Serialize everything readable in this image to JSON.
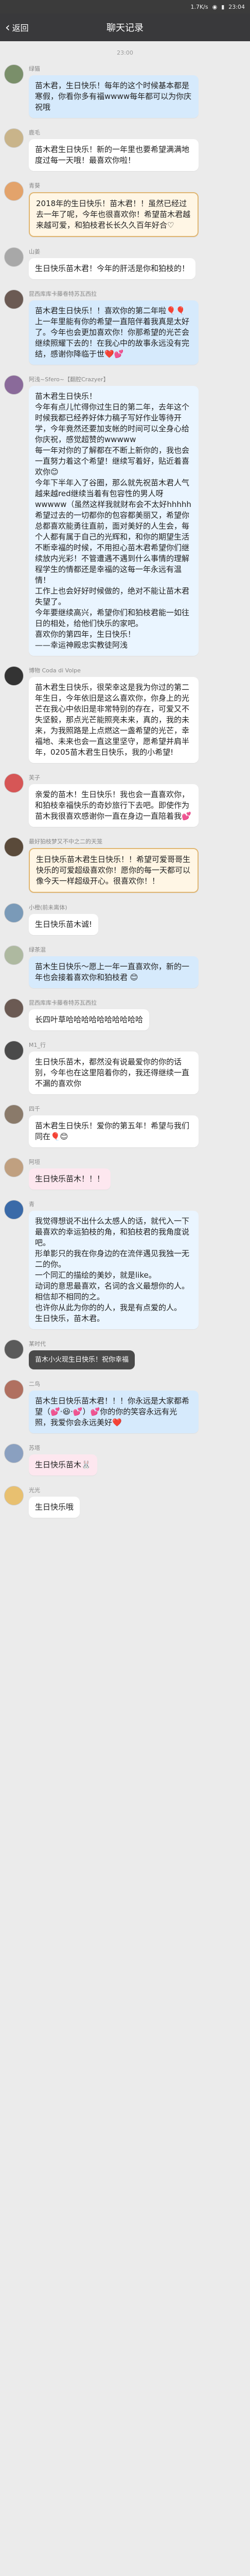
{
  "status_bar": {
    "signal": "1.7K/s",
    "battery": "23:04"
  },
  "nav": {
    "back_label": "返回",
    "title": "聊天记录"
  },
  "time_label": "23:00",
  "messages": [
    {
      "name": "绿猫",
      "avatar_color": "#7a8f6a",
      "style": "blue",
      "text": "苗木君，生日快乐！每年的这个时候基本都是寒假，你看你多有福wwww每年都可以为你庆祝哦"
    },
    {
      "name": "鹿毛",
      "avatar_color": "#c9b48a",
      "style": "plain",
      "text": "苗木君生日快乐！新的一年里也要希望满满地度过每一天哦！最喜欢你啦！"
    },
    {
      "name": "青葵",
      "avatar_color": "#e3a36b",
      "style": "gold",
      "text": "2018年的生日快乐！苗木君！！虽然已经过去一年了呢，今年也很喜欢你！希望苗木君越来越可爱，和狛枝君长长久久百年好合♡"
    },
    {
      "name": "山姜",
      "avatar_color": "#a8a8a8",
      "style": "plain",
      "text": "生日快乐苗木君！今年的肝活是你和狛枝的！"
    },
    {
      "name": "昆西库库卡藤卷特苏瓦西拉",
      "avatar_color": "#6b5a53",
      "style": "blue",
      "text": "苗木君生日快乐！！喜欢你的第二年啦🎈🎈上一年里能有你的希望一直陪伴着我真是太好了。今年也会更加喜欢你！你那希望的光芒会继续照耀下去的！在我心中的故事永远没有完结，感谢你降临于世❤️💕"
    },
    {
      "name": "阿浅~Sfero~【翻腔Crazyer】",
      "avatar_color": "#8a6a9a",
      "style": "lightblue",
      "text": "苗木君生日快乐！\n今年有点儿忙得你过生日的第二年，去年这个时候我都已经养好体力稿子写好作业等待开学，今年竟然还要加支帐的时间可以全身心给你庆祝，感觉超赞的wwwww\n每一年对你的了解都在不断上新你的，我也会一直努力着这个希望！继续写着好，贴近着喜欢你😊\n今年下半年入了谷圈，那么就先祝苗木君人气越来越red继续当着有包容性的男人呀wwwww（虽然这样我就财布会不太好hhhhh\n希望过去的一切都你的包容都美丽又，希望你总都喜欢能勇往直前，面对美好的人生会，每个人都有属于自己的光辉和，和你的期望生活不断幸福的时候，不用担心苗木君希望你们继续放内光彩！不管遭遇不遇到什么事情的理解程学生的情都还是幸福的这每一年永远有温情！\n工作上也会好好时候做的，绝对不能让苗木君失望了。\n今年要继续高兴，希望你们和狛枝君能一如往日的相处，给他们快乐的家吧。\n喜欢你的第四年，生日快乐！\n——幸运神殿忠实教徒阿浅"
    },
    {
      "name": "博物 Coda di Volpe",
      "avatar_color": "#333333",
      "style": "plain",
      "text": "苗木君生日快乐，很荣幸这是我为你过的第二年生日，今年依旧是这么喜欢你，你身上的光芒在我心中依旧是非常特别的存在，可爱又不失坚毅，那点光芒能照亮未来，真的，我的未来，为我照路是上点燃这一盏希望的光芒，幸福地、未来也会一直这里坚守，愿希望并肩半年，0205苗木君生日快乐，我的小希望!"
    },
    {
      "name": "芙子",
      "avatar_color": "#d65656",
      "style": "plain",
      "text": "亲爱的苗木！生日快乐！我也会一直喜欢你，和狛枝幸福快乐的奇妙旅行下去吧。即使作为苗木我很喜欢感谢你一直在身边一直陪着我💕"
    },
    {
      "name": "最好狛枝梦又不中之二的天笼",
      "avatar_color": "#5a4a3a",
      "style": "gold",
      "text": "生日快乐苗木君生日快乐！！希望可爱哥哥生快乐的可爱超级喜欢你！愿你的每一天都可以像今天一样超级开心。很喜欢你！！"
    },
    {
      "name": "小橙(前未离体)",
      "avatar_color": "#7a9ab8",
      "style": "plain",
      "text": "生日快乐苗木诚!"
    },
    {
      "name": "绿茶混",
      "avatar_color": "#aeb9a0",
      "style": "blue",
      "text": "苗木生日快乐～愿上一年一直喜欢你，新的一年也会接着喜欢你和狛枝君 😊"
    },
    {
      "name": "昆西库库卡藤卷特苏瓦西拉",
      "avatar_color": "#6b5a53",
      "style": "plain",
      "text": "长四叶草哈哈哈哈哈哈哈哈哈哈"
    },
    {
      "name": "M1_行",
      "avatar_color": "#4a4a4a",
      "style": "plain",
      "text": "生日快乐苗木，都然没有说最爱你的你的话别，今年也在这里陪着你的，我还得继续一直不漏的喜欢你"
    },
    {
      "name": "四千",
      "avatar_color": "#8a7a6a",
      "style": "plain",
      "text": "苗木君生日快乐！爱你的第五年！希望与我们同在🎈😊"
    },
    {
      "name": "阿垣",
      "avatar_color": "#c0a080",
      "style": "pink",
      "text": "生日快乐苗木！！！"
    },
    {
      "name": "青",
      "avatar_color": "#3a6aa8",
      "style": "lightblue",
      "text": "我觉得想说不出什么太感人的话，就代入一下最喜欢的幸运狛枝的角，和狛枝君的我角度说吧。\n形单影只的我在你身边的在流伴遇见我独一无二的你。\n一个同汇的描绘的美妙，就是like。\n动词的意思最喜欢，名词的含义最想你的人。\n相信却不相同的之。\n也许你从此为你的的人，我是有点爱的人。\n生日快乐，苗木君。"
    },
    {
      "name": "某时代",
      "avatar_color": "#5a5a5a",
      "style": "dark",
      "text": "苗木小火现生日快乐！祝你幸福"
    },
    {
      "name": "二鸟",
      "avatar_color": "#b07060",
      "style": "blue",
      "text": "苗木生日快乐苗木君！！！你永远是大家都希望（💕·😆·💕）💕你的你的笑容永远有光照，我爱你会永远美好❤️"
    },
    {
      "name": "苏塔",
      "avatar_color": "#8aa0c0",
      "style": "pink",
      "text": "生日快乐苗木🐰"
    },
    {
      "name": "光光",
      "avatar_color": "#e8c070",
      "style": "plain",
      "text": "生日快乐哦"
    }
  ]
}
